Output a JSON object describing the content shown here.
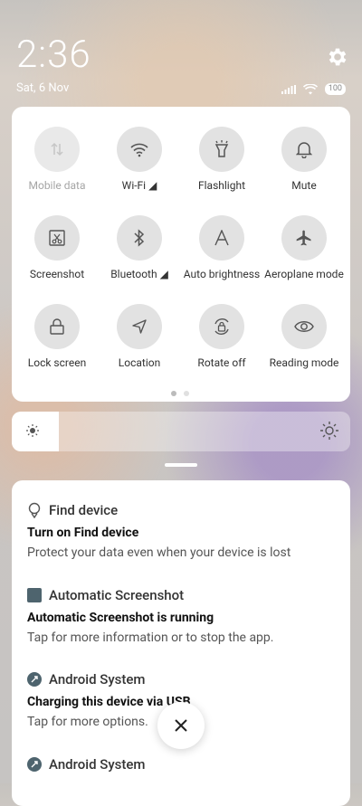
{
  "status": {
    "time": "2:36",
    "date": "Sat, 6 Nov",
    "battery": "100"
  },
  "tiles": [
    {
      "label": "Mobile data",
      "icon": "mobile-data-icon"
    },
    {
      "label": "Wi-Fi ◢",
      "icon": "wifi-icon"
    },
    {
      "label": "Flashlight",
      "icon": "flashlight-icon"
    },
    {
      "label": "Mute",
      "icon": "bell-icon"
    },
    {
      "label": "Screenshot",
      "icon": "screenshot-icon"
    },
    {
      "label": "Bluetooth ◢",
      "icon": "bluetooth-icon"
    },
    {
      "label": "Auto brightness",
      "icon": "auto-brightness-icon"
    },
    {
      "label": "Aeroplane mode",
      "icon": "airplane-icon"
    },
    {
      "label": "Lock screen",
      "icon": "lock-icon"
    },
    {
      "label": "Location",
      "icon": "location-icon"
    },
    {
      "label": "Rotate off",
      "icon": "rotate-lock-icon"
    },
    {
      "label": "Reading mode",
      "icon": "eye-icon"
    }
  ],
  "brightness": {
    "level_percent": 14
  },
  "notifications": [
    {
      "app": "Find device",
      "title": "Turn on Find device",
      "body": "Protect your data even when your device is lost"
    },
    {
      "app": "Automatic Screenshot",
      "title": "Automatic Screenshot is running",
      "body": "Tap for more information or to stop the app."
    },
    {
      "app": "Android System",
      "title": "Charging this device via USB",
      "body": "Tap for more options."
    },
    {
      "app": "Android System",
      "title": "",
      "body": ""
    }
  ]
}
